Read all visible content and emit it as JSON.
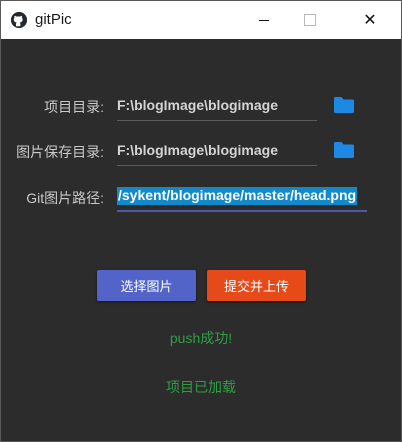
{
  "window": {
    "title": "gitPic",
    "close_glyph": "✕"
  },
  "form": {
    "project_dir_label": "项目目录:",
    "project_dir_value": "F:\\blogImage\\blogimage",
    "save_dir_label": "图片保存目录:",
    "save_dir_value": "F:\\blogImage\\blogimage",
    "git_path_label": "Git图片路径:",
    "git_path_value": "/sykent/blogimage/master/head.png"
  },
  "buttons": {
    "select_image": "选择图片",
    "submit_upload": "提交并上传"
  },
  "status": {
    "push_message": "push成功!",
    "project_message": "项目已加载"
  },
  "colors": {
    "background": "#2d2c2c",
    "folder_icon": "#1e88e5",
    "select_button": "#5264c8",
    "upload_button": "#e64a19",
    "status_text": "#2e9e44",
    "selection": "#1289c8"
  },
  "icons": {
    "app": "github-icon",
    "folder": "folder-icon"
  }
}
